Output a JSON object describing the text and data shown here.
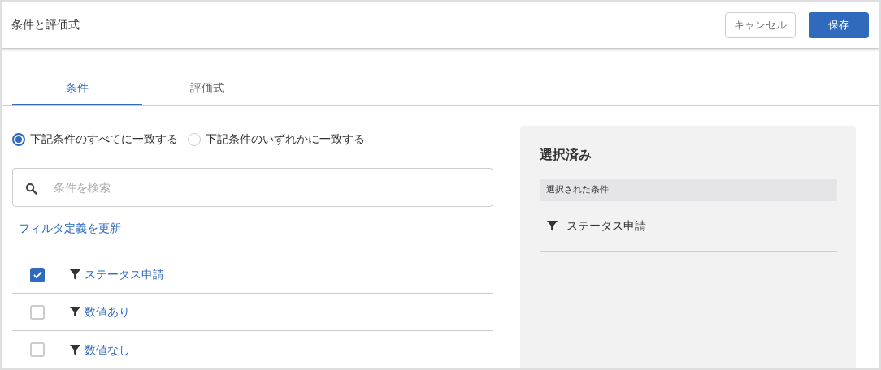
{
  "header": {
    "title": "条件と評価式",
    "buttons": [
      {
        "kind": "secondary",
        "label": "キャンセル"
      },
      {
        "kind": "primary",
        "label": "保存"
      }
    ]
  },
  "tabs": [
    {
      "label": "条件",
      "selected": true
    },
    {
      "label": "評価式",
      "selected": false
    }
  ],
  "match_options": [
    {
      "label": "下記条件のすべてに一致する",
      "selected": true
    },
    {
      "label": "下記条件のいずれかに一致する",
      "selected": false
    }
  ],
  "search": {
    "placeholder": "条件を検索"
  },
  "update_link": "フィルタ定義を更新",
  "conditions": [
    {
      "label": "ステータス申請",
      "checked": true
    },
    {
      "label": "数値あり",
      "checked": false
    },
    {
      "label": "数値なし",
      "checked": false
    }
  ],
  "selected_panel": {
    "title": "選択済み",
    "section": "選択された条件",
    "items": [
      "ステータス申請"
    ]
  }
}
